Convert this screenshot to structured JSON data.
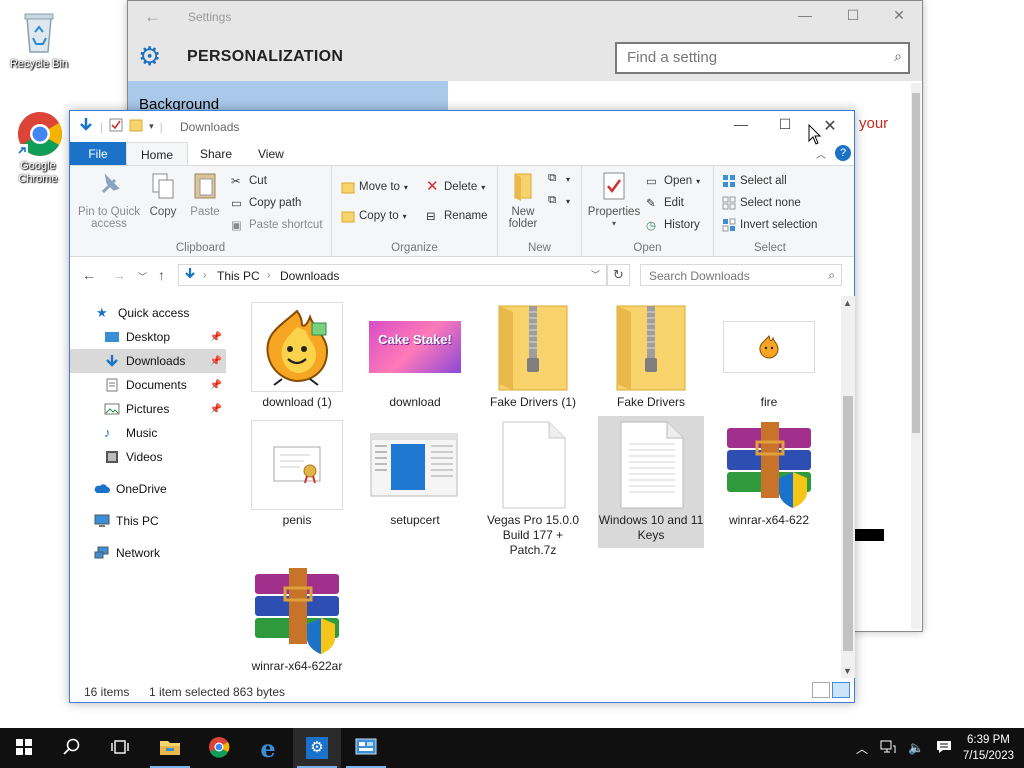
{
  "desktop": {
    "icons": [
      {
        "label": "Recycle Bin"
      },
      {
        "label": "Google Chrome"
      }
    ]
  },
  "settings": {
    "title": "Settings",
    "heading": "PERSONALIZATION",
    "search_placeholder": "Find a setting",
    "left_item": "Background",
    "right_text_fragment": "your"
  },
  "explorer": {
    "title": "Downloads",
    "tabs": [
      "File",
      "Home",
      "Share",
      "View"
    ],
    "ribbon": {
      "clipboard": {
        "group": "Clipboard",
        "pin": "Pin to Quick access",
        "copy": "Copy",
        "paste": "Paste",
        "cut": "Cut",
        "copy_path": "Copy path",
        "paste_shortcut": "Paste shortcut"
      },
      "organize": {
        "group": "Organize",
        "move_to": "Move to",
        "copy_to": "Copy to",
        "delete": "Delete",
        "rename": "Rename"
      },
      "new": {
        "group": "New",
        "new_folder": "New folder"
      },
      "open": {
        "group": "Open",
        "properties": "Properties",
        "open": "Open",
        "edit": "Edit",
        "history": "History"
      },
      "select": {
        "group": "Select",
        "select_all": "Select all",
        "select_none": "Select none",
        "invert": "Invert selection"
      }
    },
    "address": {
      "crumbs": [
        "This PC",
        "Downloads"
      ],
      "search_placeholder": "Search Downloads"
    },
    "nav": [
      {
        "label": "Quick access"
      },
      {
        "label": "Desktop"
      },
      {
        "label": "Downloads"
      },
      {
        "label": "Documents"
      },
      {
        "label": "Pictures"
      },
      {
        "label": "Music"
      },
      {
        "label": "Videos"
      },
      {
        "label": "OneDrive"
      },
      {
        "label": "This PC"
      },
      {
        "label": "Network"
      }
    ],
    "files": [
      {
        "name": "download (1)"
      },
      {
        "name": "download",
        "thumb_text": "Cake Stake!"
      },
      {
        "name": "Fake Drivers (1)"
      },
      {
        "name": "Fake Drivers"
      },
      {
        "name": "fire"
      },
      {
        "name": "penis"
      },
      {
        "name": "setupcert"
      },
      {
        "name": "Vegas Pro 15.0.0 Build 177 + Patch.7z"
      },
      {
        "name": "Windows 10 and 11 Keys"
      },
      {
        "name": "winrar-x64-622"
      },
      {
        "name": "winrar-x64-622ar"
      }
    ],
    "status": {
      "count": "16 items",
      "selected": "1 item selected",
      "size": "863 bytes"
    }
  },
  "taskbar": {
    "time": "6:39 PM",
    "date": "7/15/2023"
  },
  "colors": {
    "accent": "#1a73c8",
    "folder": "#f8d26b",
    "taskbar": "#101010"
  }
}
